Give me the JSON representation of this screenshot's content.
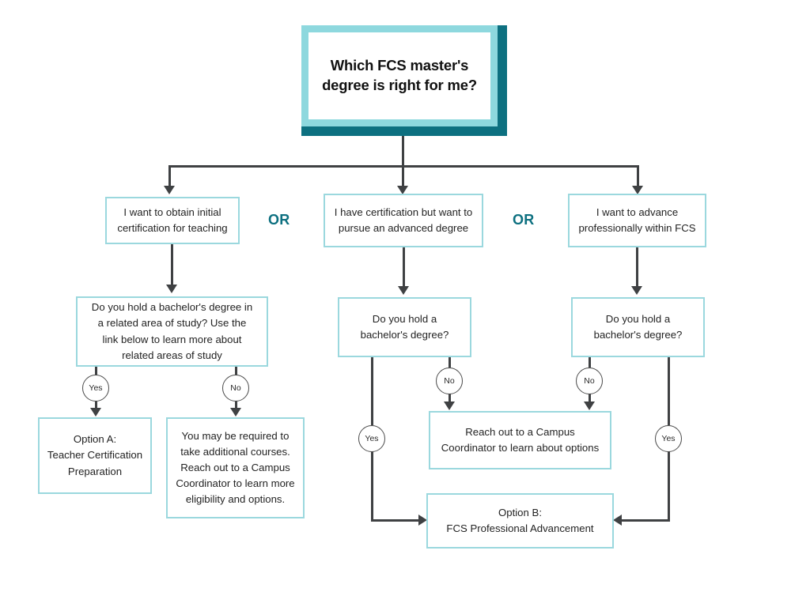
{
  "diagram": {
    "title_card": {
      "text": "Which FCS master's\ndegree is right for me?"
    },
    "connector_labels": {
      "or_1": "OR",
      "or_2": "OR",
      "yes_left": "Yes",
      "no_left": "No",
      "yes_middle": "Yes",
      "no_middle": "No",
      "yes_right": "Yes",
      "no_right": "No"
    },
    "branches": {
      "left": {
        "choice": "I want to obtain initial\ncertification for teaching",
        "question": "Do you hold a bachelor's degree in\na related area of study? Use the\nlink below to learn more about\nrelated areas of study",
        "yes_outcome": "Option A:\nTeacher Certification\nPreparation",
        "no_outcome": "You may be required to\ntake additional courses.\nReach out to a Campus\nCoordinator to learn more\neligibility and options."
      },
      "middle": {
        "choice": "I have certification but want to\npursue an advanced degree",
        "question": "Do you hold a\nbachelor's degree?"
      },
      "right": {
        "choice": "I want to advance\nprofessionally within FCS",
        "question": "Do you hold a\nbachelor's degree?"
      }
    },
    "shared_outcomes": {
      "campus_coordinator": "Reach out to a Campus\nCoordinator to learn about options",
      "option_b": "Option B:\nFCS Professional Advancement"
    },
    "colors": {
      "box_border": "#9bd8de",
      "accent_dark_teal": "#0d7080",
      "accent_light_teal": "#8ed8de",
      "connector": "#3f4143",
      "background": "#ffffff"
    }
  }
}
